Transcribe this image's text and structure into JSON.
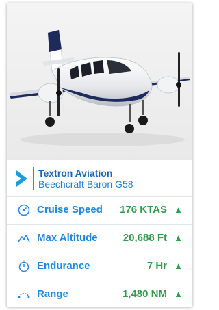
{
  "aircraft": {
    "manufacturer": "Textron Aviation",
    "model": "Beechcraft Baron G58",
    "image_icon": "aircraft-photo"
  },
  "stats": [
    {
      "label": "Cruise Speed",
      "value": "176 KTAS",
      "icon": "speedometer-icon",
      "trend": "▲"
    },
    {
      "label": "Max Altitude",
      "value": "20,688 Ft",
      "icon": "mountain-icon",
      "trend": "▲"
    },
    {
      "label": "Endurance",
      "value": "7 Hr",
      "icon": "stopwatch-icon",
      "trend": "▲"
    },
    {
      "label": "Range",
      "value": "1,480 NM",
      "icon": "range-arc-icon",
      "trend": "▲"
    }
  ],
  "colors": {
    "accent_blue": "#1e88e5",
    "value_green": "#2e9e4a",
    "chevron_blue": "#1a9be0"
  }
}
